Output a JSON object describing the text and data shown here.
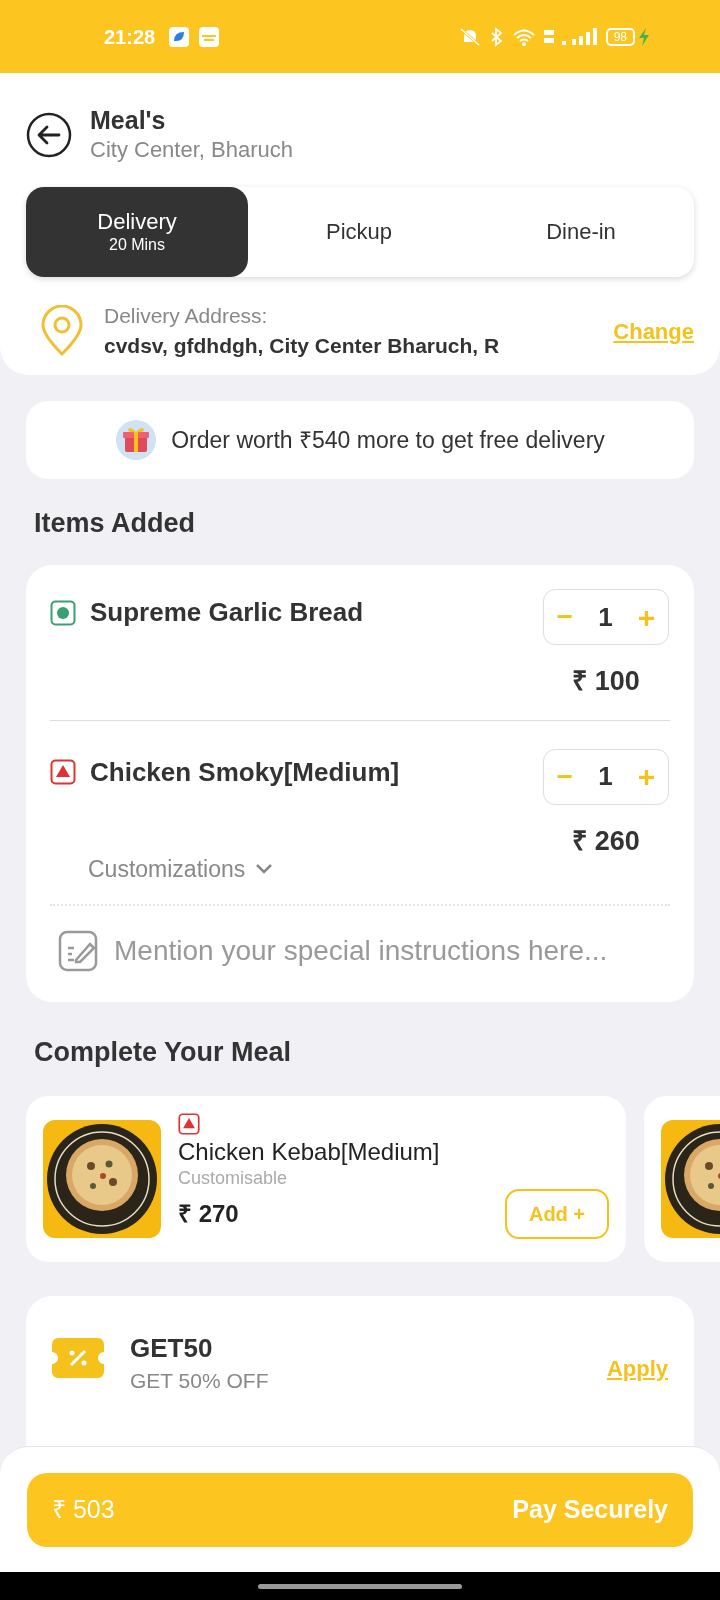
{
  "status_bar": {
    "time": "21:28",
    "battery": "98"
  },
  "header": {
    "title": "Meal's",
    "subtitle": "City Center, Bharuch"
  },
  "tabs": [
    {
      "label": "Delivery",
      "sublabel": "20 Mins",
      "selected": true
    },
    {
      "label": "Pickup",
      "selected": false
    },
    {
      "label": "Dine-in",
      "selected": false
    }
  ],
  "address": {
    "label": "Delivery Address:",
    "value": "cvdsv, gfdhdgh, City Center Bharuch, R",
    "action": "Change"
  },
  "banner": "Order worth ₹540 more to get free delivery",
  "items_title": "Items Added",
  "items": [
    {
      "kind": "veg",
      "name": "Supreme Garlic Bread",
      "quantity": "1",
      "price": "₹ 100",
      "minus": "−",
      "plus": "+"
    },
    {
      "kind": "nonveg",
      "name": "Chicken Smoky[Medium]",
      "quantity": "1",
      "price": "₹ 260",
      "minus": "−",
      "plus": "+",
      "customizations": "Customizations"
    }
  ],
  "instructions": {
    "placeholder": "Mention your special instructions here..."
  },
  "suggest_title": "Complete Your Meal",
  "suggestions": [
    {
      "kind": "nonveg",
      "name": "Chicken Kebab[Medium]",
      "note": "Customisable",
      "price": "₹ 270",
      "action": "Add +"
    }
  ],
  "coupon": {
    "code": "GET50",
    "description": "GET 50% OFF",
    "action": "Apply"
  },
  "footer": {
    "total": "₹ 503",
    "action": "Pay Securely"
  }
}
